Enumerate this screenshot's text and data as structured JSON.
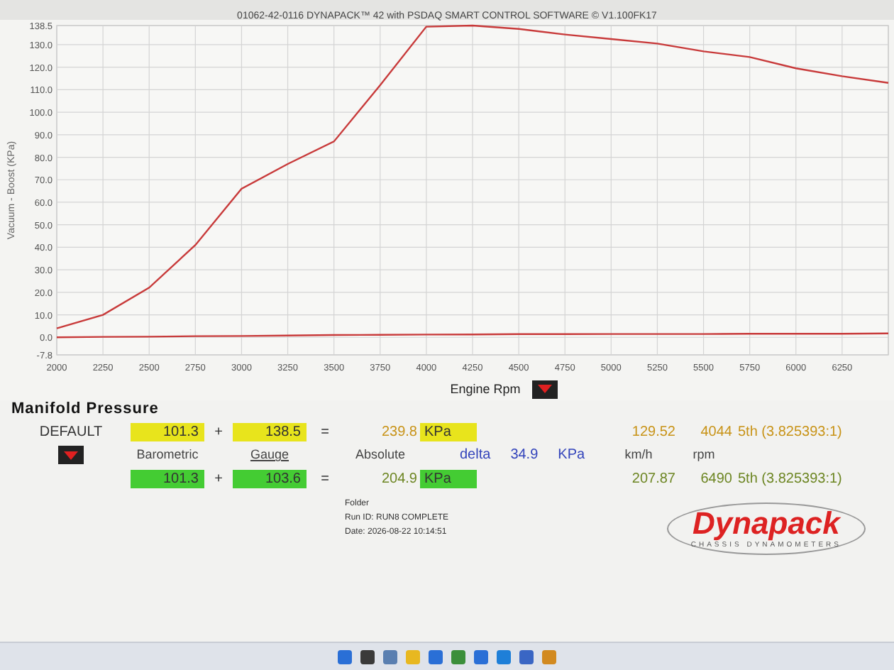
{
  "window": {
    "title": "01062-42-0116 DYNAPACK™ 42 with PSDAQ SMART CONTROL SOFTWARE © V1.100FK17"
  },
  "chart": {
    "chart_data": {
      "type": "line",
      "xlabel": "Engine Rpm",
      "ylabel": "Vacuum - Boost (KPa)",
      "grid": true,
      "x": [
        2000,
        2250,
        2500,
        2750,
        3000,
        3250,
        3500,
        3750,
        4000,
        4250,
        4500,
        4750,
        5000,
        5250,
        5500,
        5750,
        6000,
        6250,
        6500
      ],
      "series": [
        {
          "color": "#c83a3a",
          "values": [
            4,
            10,
            22,
            41,
            66,
            77,
            87,
            112,
            138,
            138.5,
            137,
            134.5,
            132.5,
            130.5,
            127,
            124.5,
            119.5,
            116,
            113
          ]
        },
        {
          "color": "#c83a3a",
          "values": [
            0,
            0.2,
            0.3,
            0.5,
            0.6,
            0.8,
            1,
            1.1,
            1.2,
            1.3,
            1.4,
            1.4,
            1.5,
            1.5,
            1.5,
            1.6,
            1.6,
            1.6,
            1.7
          ]
        }
      ],
      "xlim": [
        2000,
        6500
      ],
      "ylim": [
        -7.8,
        138.5
      ],
      "xticks": [
        2000,
        2250,
        2500,
        2750,
        3000,
        3250,
        3500,
        3750,
        4000,
        4250,
        4500,
        4750,
        5000,
        5250,
        5500,
        5750,
        6000,
        6250
      ],
      "yticks": [
        {
          "value": -7.8,
          "label": "-7.8"
        },
        {
          "value": 0,
          "label": "0.0"
        },
        {
          "value": 10,
          "label": "10.0"
        },
        {
          "value": 20,
          "label": "20.0"
        },
        {
          "value": 30,
          "label": "30.0"
        },
        {
          "value": 40,
          "label": "40.0"
        },
        {
          "value": 50,
          "label": "50.0"
        },
        {
          "value": 60,
          "label": "60.0"
        },
        {
          "value": 70,
          "label": "70.0"
        },
        {
          "value": 80,
          "label": "80.0"
        },
        {
          "value": 90,
          "label": "90.0"
        },
        {
          "value": 100,
          "label": "100.0"
        },
        {
          "value": 110,
          "label": "110.0"
        },
        {
          "value": 120,
          "label": "120.0"
        },
        {
          "value": 130,
          "label": "130.0"
        },
        {
          "value": 138.5,
          "label": "138.5"
        }
      ]
    }
  },
  "manifold_pressure": {
    "title": "Manifold Pressure",
    "preset": "DEFAULT",
    "rows": [
      {
        "color": "#e8e41c",
        "barometric": "101.3",
        "plus": "+",
        "gauge": "138.5",
        "equals": "=",
        "absolute": "239.8",
        "unit": "KPa",
        "speed": "129.52",
        "rpm": "4044",
        "gear": "5th (3.825393:1)"
      },
      {
        "color": "#44cc33",
        "barometric": "101.3",
        "plus": "+",
        "gauge": "103.6",
        "equals": "=",
        "absolute": "204.9",
        "unit": "KPa",
        "speed": "207.87",
        "rpm": "6490",
        "gear": "5th (3.825393:1)"
      }
    ],
    "labels": {
      "barometric": "Barometric",
      "gauge": "Gauge",
      "absolute": "Absolute",
      "speed": "km/h",
      "rpm": "rpm"
    },
    "delta": {
      "label": "delta",
      "value": "34.9",
      "unit": "KPa"
    }
  },
  "run_info": {
    "folder": "Folder",
    "run_id": "Run ID: RUN8 COMPLETE",
    "date": "Date: 2026-08-22 10:14:51"
  },
  "logo": {
    "name": "Dynapack",
    "tagline": "CHASSIS DYNAMOMETERS"
  }
}
